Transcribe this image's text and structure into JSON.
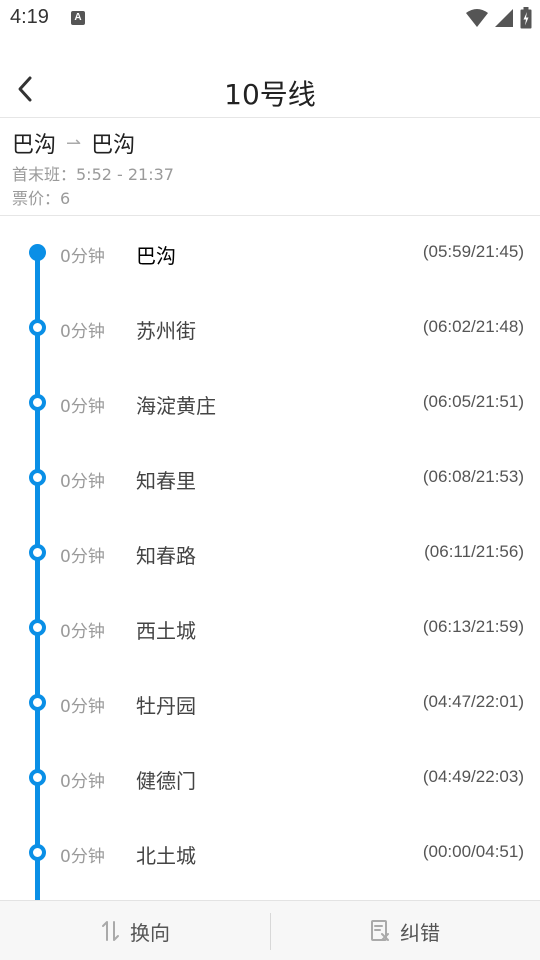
{
  "status_bar": {
    "time": "4:19",
    "notif_letter": "A"
  },
  "header": {
    "title": "10号线"
  },
  "route": {
    "from": "巴沟",
    "to": "巴沟",
    "arrow": "⇀",
    "first_last": "首末班：5:52 - 21:37",
    "fare": "票价：6"
  },
  "stations": [
    {
      "wait": "0分钟",
      "name": "巴沟",
      "times": "(05:59/21:45)"
    },
    {
      "wait": "0分钟",
      "name": "苏州街",
      "times": "(06:02/21:48)"
    },
    {
      "wait": "0分钟",
      "name": "海淀黄庄",
      "times": "(06:05/21:51)"
    },
    {
      "wait": "0分钟",
      "name": "知春里",
      "times": "(06:08/21:53)"
    },
    {
      "wait": "0分钟",
      "name": "知春路",
      "times": "(06:11/21:56)"
    },
    {
      "wait": "0分钟",
      "name": "西土城",
      "times": "(06:13/21:59)"
    },
    {
      "wait": "0分钟",
      "name": "牡丹园",
      "times": "(04:47/22:01)"
    },
    {
      "wait": "0分钟",
      "name": "健德门",
      "times": "(04:49/22:03)"
    },
    {
      "wait": "0分钟",
      "name": "北土城",
      "times": "(00:00/04:51)"
    }
  ],
  "bottom_bar": {
    "reverse_label": "换向",
    "report_label": "纠错"
  },
  "colors": {
    "line": "#0a8fe6"
  }
}
